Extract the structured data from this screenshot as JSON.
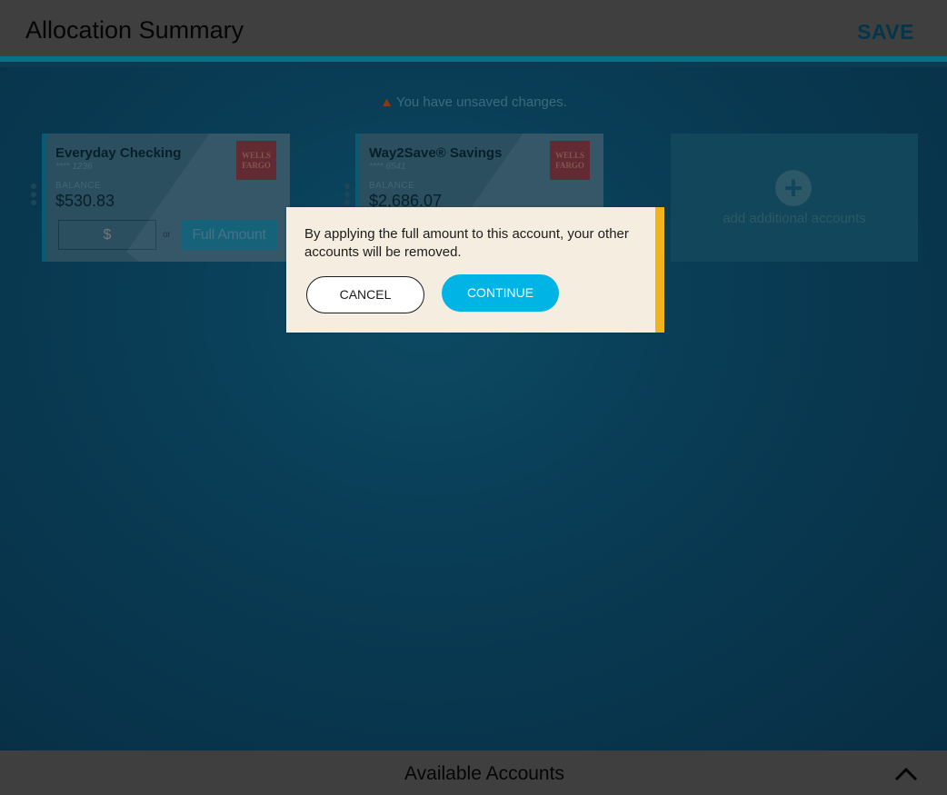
{
  "header": {
    "title": "Allocation Summary",
    "save_label": "SAVE"
  },
  "banner": {
    "warning_text": "You have unsaved changes.",
    "icon": "warning-icon"
  },
  "accounts": [
    {
      "name": "Everyday Checking",
      "masked_number": "**** 1236",
      "balance_label": "BALANCE",
      "balance": "$530.83",
      "amount_placeholder": "$",
      "or_label": "or",
      "full_amount_label": "Full Amount",
      "logo_text": "WELLS FARGO"
    },
    {
      "name": "Way2Save® Savings",
      "masked_number": "**** 6541",
      "balance_label": "BALANCE",
      "balance": "$2,686.07",
      "logo_text": "WELLS FARGO"
    }
  ],
  "add_tile": {
    "label": "add additional accounts",
    "icon": "plus-circle-icon"
  },
  "modal": {
    "message": "By applying the full amount to this account, your other accounts will be removed.",
    "cancel_label": "CANCEL",
    "continue_label": "CONTINUE"
  },
  "footer": {
    "title": "Available Accounts",
    "icon": "chevron-up-icon"
  },
  "colors": {
    "accent": "#00b4e5",
    "warning_bar": "#f2b21b",
    "modal_bg": "#f4ede0"
  }
}
